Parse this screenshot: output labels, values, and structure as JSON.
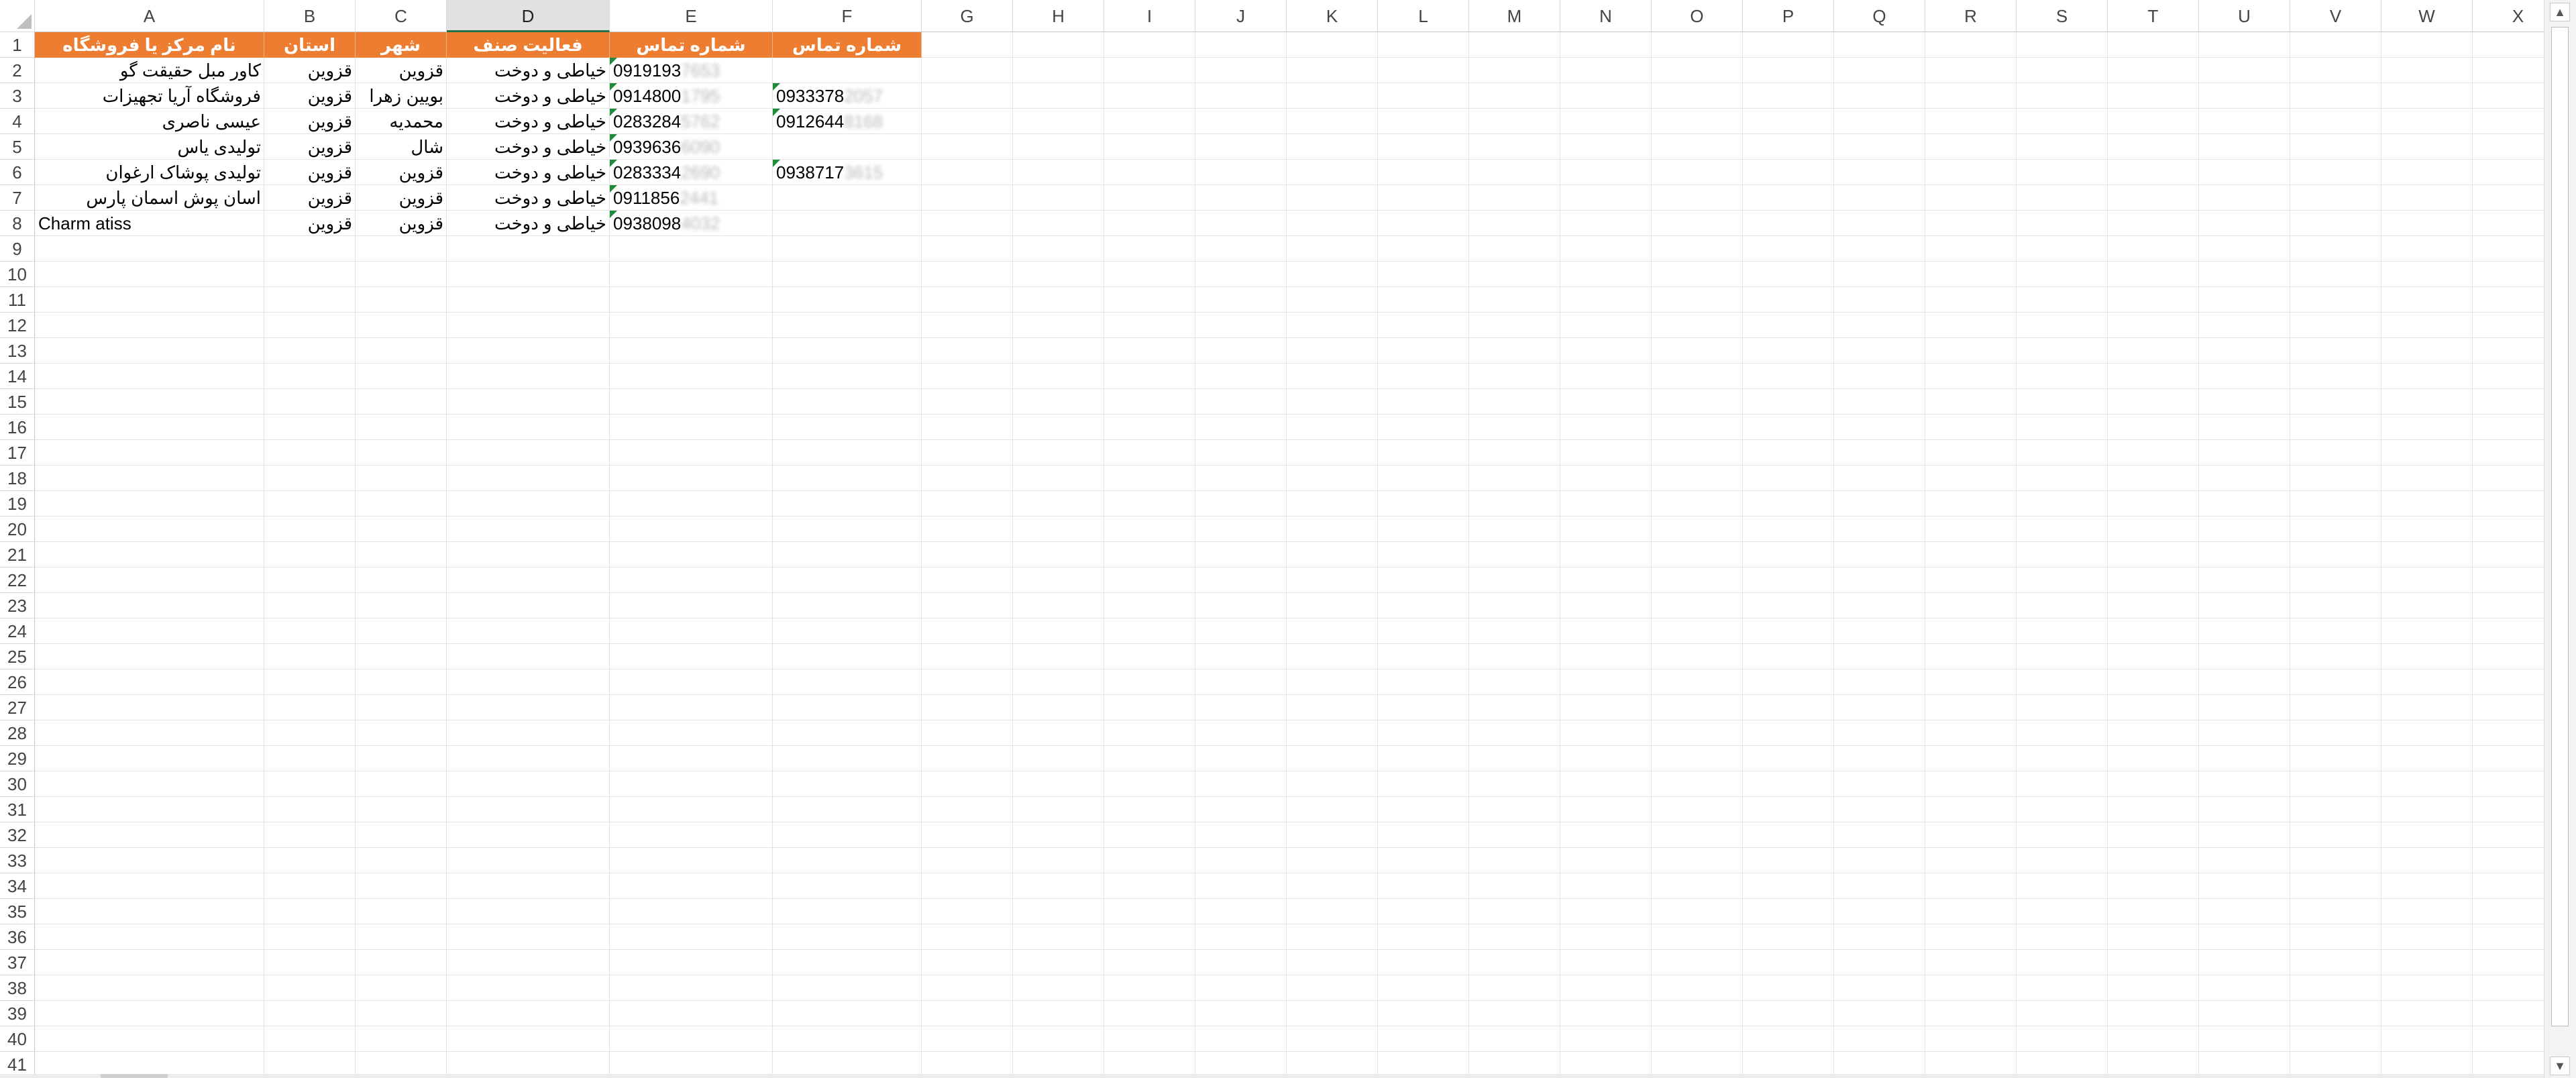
{
  "columns": [
    "A",
    "B",
    "C",
    "D",
    "E",
    "F",
    "G",
    "H",
    "I",
    "J",
    "K",
    "L",
    "M",
    "N",
    "O",
    "P",
    "Q",
    "R",
    "S",
    "T",
    "U",
    "V",
    "W",
    "X"
  ],
  "selected_column": "D",
  "rows": [
    "1",
    "2",
    "3",
    "4",
    "5",
    "6",
    "7",
    "8",
    "9",
    "10",
    "11",
    "12",
    "13",
    "14",
    "15",
    "16",
    "17",
    "18",
    "19",
    "20",
    "21",
    "22",
    "23",
    "24",
    "25",
    "26",
    "27",
    "28",
    "29",
    "30",
    "31",
    "32",
    "33",
    "34",
    "35",
    "36",
    "37",
    "38",
    "39",
    "40",
    "41"
  ],
  "header_row": {
    "A": "نام مرکز یا فروشگاه",
    "B": "استان",
    "C": "شهر",
    "D": "فعالیت صنف",
    "E": "شماره تماس",
    "F": "شماره تماس"
  },
  "data_rows": [
    {
      "A": "کاور مبل حقیقت گو",
      "B": "قزوین",
      "C": "قزوین",
      "D": "خیاطی و دوخت",
      "E": "0919193",
      "E_hidden": "7653",
      "F": "",
      "F_hidden": ""
    },
    {
      "A": "فروشگاه آریا تجهیزات",
      "B": "قزوین",
      "C": "بویین زهرا",
      "D": "خیاطی و دوخت",
      "E": "0914800",
      "E_hidden": "1795",
      "F": "0933378",
      "F_hidden": "2057"
    },
    {
      "A": "عیسی ناصری",
      "B": "قزوین",
      "C": "محمدیه",
      "D": "خیاطی و دوخت",
      "E": "0283284",
      "E_hidden": "5762",
      "F": "0912644",
      "F_hidden": "8168"
    },
    {
      "A": "تولیدی یاس",
      "B": "قزوین",
      "C": "شال",
      "D": "خیاطی و دوخت",
      "E": "0939636",
      "E_hidden": "6090",
      "F": "",
      "F_hidden": ""
    },
    {
      "A": "تولیدی پوشاک ارغوان",
      "B": "قزوین",
      "C": "قزوین",
      "D": "خیاطی و دوخت",
      "E": "0283334",
      "E_hidden": "2690",
      "F": "0938717",
      "F_hidden": "3615"
    },
    {
      "A": "اسان پوش اسمان پارس",
      "B": "قزوین",
      "C": "قزوین",
      "D": "خیاطی و دوخت",
      "E": "0911856",
      "E_hidden": "2441",
      "F": "",
      "F_hidden": ""
    },
    {
      "A": "Charm atiss",
      "B": "قزوین",
      "C": "قزوین",
      "D": "خیاطی و دوخت",
      "E": "0938098",
      "E_hidden": "4032",
      "F": "",
      "F_hidden": ""
    }
  ],
  "colors": {
    "header_fill": "#ed7d31",
    "header_text": "#ffffff",
    "selection_accent": "#217346",
    "error_flag": "#1e8c3a"
  },
  "icons": {
    "scroll_up": "scroll-up-icon",
    "scroll_down": "scroll-down-icon",
    "select_all": "select-all-icon"
  }
}
